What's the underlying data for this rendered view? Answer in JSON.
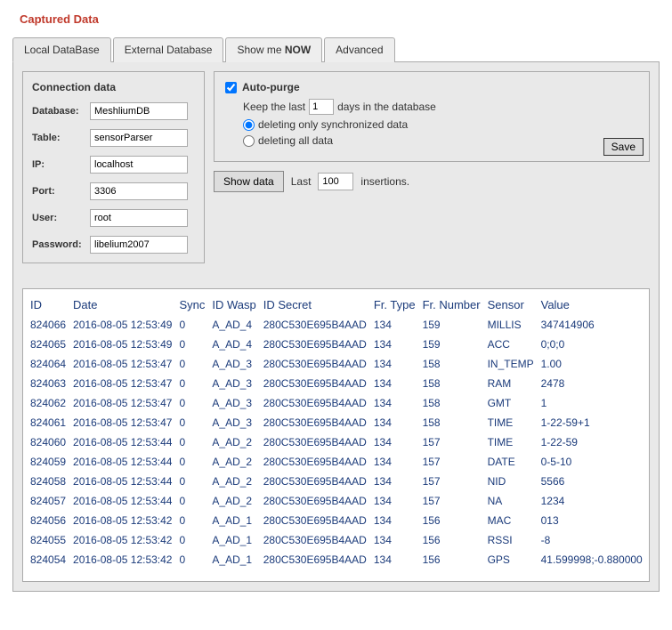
{
  "title": "Captured Data",
  "tabs": {
    "local": "Local DataBase",
    "external": "External Database",
    "show_prefix": "Show me ",
    "show_bold": "NOW",
    "advanced": "Advanced"
  },
  "connection": {
    "heading": "Connection data",
    "labels": {
      "database": "Database:",
      "table": "Table:",
      "ip": "IP:",
      "port": "Port:",
      "user": "User:",
      "password": "Password:"
    },
    "values": {
      "database": "MeshliumDB",
      "table": "sensorParser",
      "ip": "localhost",
      "port": "3306",
      "user": "root",
      "password": "libelium2007"
    }
  },
  "autopurge": {
    "label": "Auto-purge",
    "checked": true,
    "keep_prefix": "Keep the last",
    "keep_value": "1",
    "keep_suffix": "days in the database",
    "opt_sync": "deleting only synchronized data",
    "opt_all": "deleting all data",
    "selected": "sync",
    "save": "Save"
  },
  "showdata": {
    "button": "Show data",
    "last_label": "Last",
    "last_value": "100",
    "suffix": "insertions."
  },
  "table": {
    "headers": [
      "ID",
      "Date",
      "Sync",
      "ID Wasp",
      "ID Secret",
      "Fr. Type",
      "Fr. Number",
      "Sensor",
      "Value"
    ],
    "rows": [
      [
        "824066",
        "2016-08-05 12:53:49",
        "0",
        "A_AD_4",
        "280C530E695B4AAD",
        "134",
        "159",
        "MILLIS",
        "347414906"
      ],
      [
        "824065",
        "2016-08-05 12:53:49",
        "0",
        "A_AD_4",
        "280C530E695B4AAD",
        "134",
        "159",
        "ACC",
        "0;0;0"
      ],
      [
        "824064",
        "2016-08-05 12:53:47",
        "0",
        "A_AD_3",
        "280C530E695B4AAD",
        "134",
        "158",
        "IN_TEMP",
        "1.00"
      ],
      [
        "824063",
        "2016-08-05 12:53:47",
        "0",
        "A_AD_3",
        "280C530E695B4AAD",
        "134",
        "158",
        "RAM",
        "2478"
      ],
      [
        "824062",
        "2016-08-05 12:53:47",
        "0",
        "A_AD_3",
        "280C530E695B4AAD",
        "134",
        "158",
        "GMT",
        "1"
      ],
      [
        "824061",
        "2016-08-05 12:53:47",
        "0",
        "A_AD_3",
        "280C530E695B4AAD",
        "134",
        "158",
        "TIME",
        "1-22-59+1"
      ],
      [
        "824060",
        "2016-08-05 12:53:44",
        "0",
        "A_AD_2",
        "280C530E695B4AAD",
        "134",
        "157",
        "TIME",
        "1-22-59"
      ],
      [
        "824059",
        "2016-08-05 12:53:44",
        "0",
        "A_AD_2",
        "280C530E695B4AAD",
        "134",
        "157",
        "DATE",
        "0-5-10"
      ],
      [
        "824058",
        "2016-08-05 12:53:44",
        "0",
        "A_AD_2",
        "280C530E695B4AAD",
        "134",
        "157",
        "NID",
        "5566"
      ],
      [
        "824057",
        "2016-08-05 12:53:44",
        "0",
        "A_AD_2",
        "280C530E695B4AAD",
        "134",
        "157",
        "NA",
        "1234"
      ],
      [
        "824056",
        "2016-08-05 12:53:42",
        "0",
        "A_AD_1",
        "280C530E695B4AAD",
        "134",
        "156",
        "MAC",
        "013"
      ],
      [
        "824055",
        "2016-08-05 12:53:42",
        "0",
        "A_AD_1",
        "280C530E695B4AAD",
        "134",
        "156",
        "RSSI",
        "-8"
      ],
      [
        "824054",
        "2016-08-05 12:53:42",
        "0",
        "A_AD_1",
        "280C530E695B4AAD",
        "134",
        "156",
        "GPS",
        "41.599998;-0.880000"
      ]
    ]
  }
}
